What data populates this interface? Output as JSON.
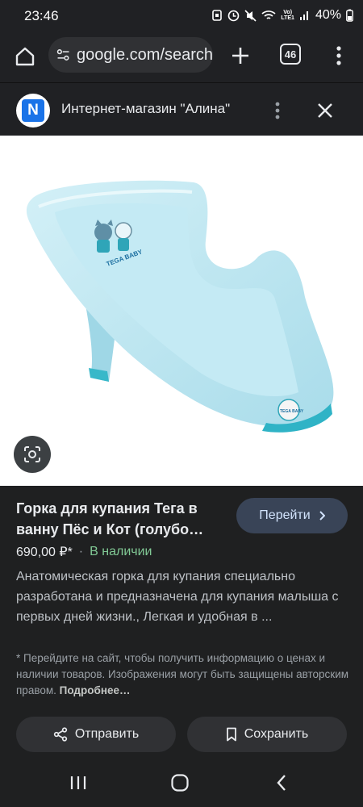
{
  "status_bar": {
    "time": "23:46",
    "network": "Vo)\nLTE1",
    "battery": "40%"
  },
  "browser": {
    "url": "google.com/search",
    "tab_count": "46"
  },
  "panel": {
    "store_name": "Интернет-магазин \"Алина\"",
    "logo_letter": "N"
  },
  "product": {
    "title": "Горка для купания Тега в ванну Пёс и Кот (голубо…",
    "goto_label": "Перейти",
    "price": "690,00 ₽*",
    "separator": "·",
    "stock": "В наличии",
    "description": "Анатомическая горка для купания специально разработана и предназначена для купания малыша с первых дней жизни., Легкая и удобная в ...",
    "note": "* Перейдите на сайт, чтобы получить информацию о ценах и наличии товаров. Изображения могут быть защищены авторским правом.",
    "note_link": "Подробнее…",
    "image_brand_text": "TEGA BABY"
  },
  "actions": {
    "share_label": "Отправить",
    "save_label": "Сохранить"
  },
  "colors": {
    "accent_button": "#394457",
    "in_stock": "#81c995",
    "product_blue": "#bfe7f2"
  }
}
